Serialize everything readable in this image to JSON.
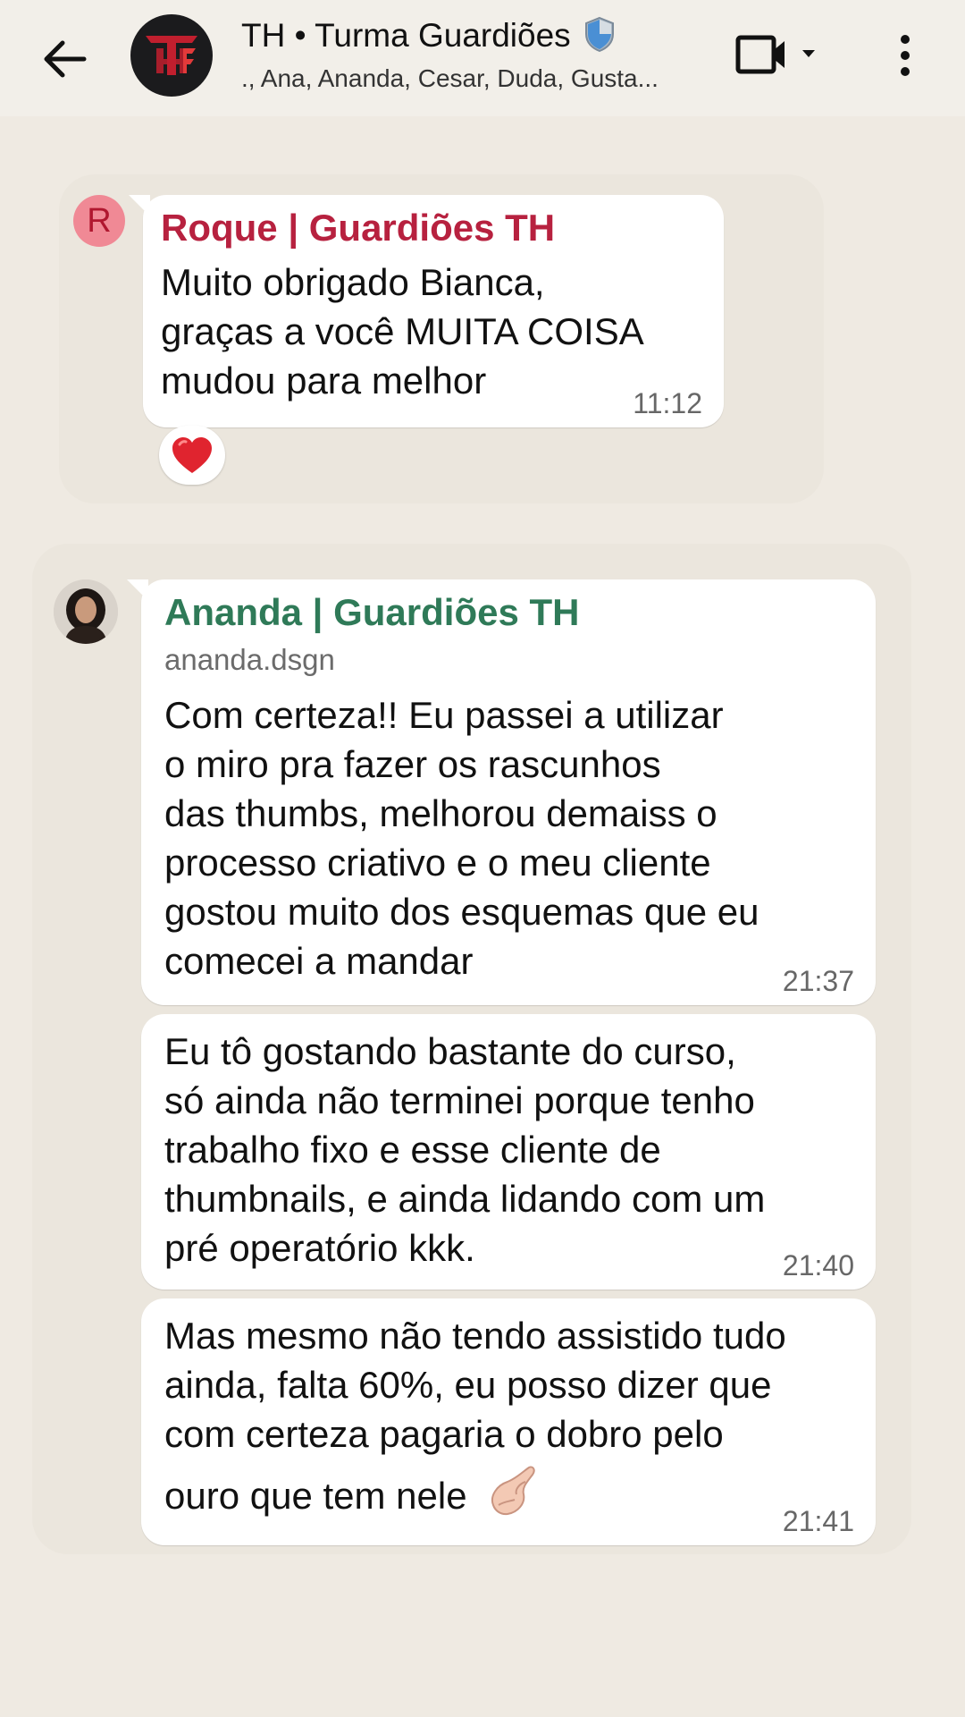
{
  "header": {
    "title": "TH • Turma Guardiões",
    "subtitle": "., Ana, Ananda, Cesar, Duda, Gusta...",
    "group_avatar_icon": "th-logo-icon",
    "title_badge_icon": "shield-icon"
  },
  "messages": [
    {
      "sender": "Roque | Guardiões TH",
      "avatar_letter": "R",
      "text": [
        "Muito obrigado Bianca,",
        "graças a você MUITA COISA",
        "mudou para melhor"
      ],
      "time": "11:12",
      "reaction": "heart-icon"
    },
    {
      "sender": "Ananda | Guardiões TH",
      "username": "ananda.dsgn",
      "text": [
        "Com certeza!! Eu passei a utilizar",
        "o miro pra fazer os rascunhos",
        "das thumbs, melhorou demaiss o",
        "processo criativo e o meu cliente",
        "gostou muito dos esquemas que eu",
        "comecei a mandar"
      ],
      "time": "21:37"
    },
    {
      "text": [
        "Eu tô gostando bastante do curso,",
        "só ainda não terminei porque tenho",
        "trabalho fixo e esse cliente de",
        "thumbnails, e ainda lidando com um",
        "pré operatório kkk."
      ],
      "time": "21:40"
    },
    {
      "text": [
        "Mas mesmo não tendo assistido tudo",
        "ainda, falta 60%, eu posso dizer que",
        "com certeza pagaria o dobro pelo",
        "ouro que tem nele"
      ],
      "time": "21:41",
      "emoji": "pinched-fingers-icon"
    }
  ],
  "colors": {
    "background": "#efeae2",
    "sender_red": "#b7213f",
    "sender_green": "#2f7a58",
    "bubble": "#ffffff"
  }
}
